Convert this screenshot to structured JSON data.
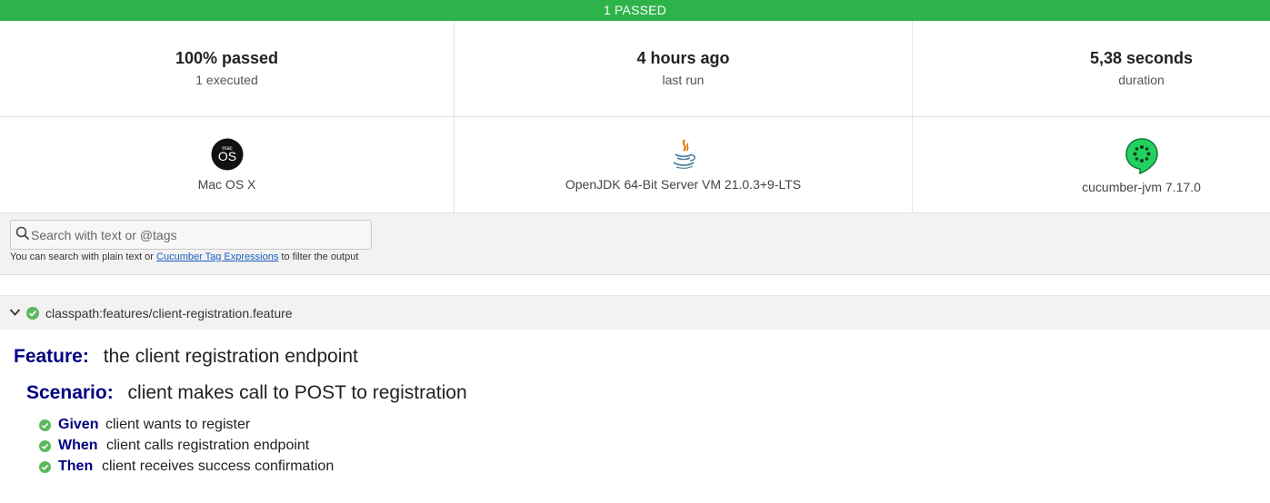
{
  "banner": {
    "text": "1 PASSED",
    "color": "#2db34a"
  },
  "stats": {
    "passed": {
      "value": "100% passed",
      "label": "1 executed"
    },
    "last_run": {
      "value": "4 hours ago",
      "label": "last run"
    },
    "duration": {
      "value": "5,38 seconds",
      "label": "duration"
    }
  },
  "environment": {
    "os": {
      "icon": "macos-icon",
      "icon_text_top": "mac",
      "icon_text_main": "OS",
      "label": "Mac OS X"
    },
    "runtime": {
      "icon": "java-icon",
      "label": "OpenJDK 64-Bit Server VM 21.0.3+9-LTS"
    },
    "framework": {
      "icon": "cucumber-icon",
      "label": "cucumber-jvm 7.17.0"
    }
  },
  "search": {
    "placeholder": "Search with text or @tags",
    "value": "",
    "help_prefix": "You can search with plain text or",
    "help_link": "Cucumber Tag Expressions",
    "help_suffix": "to filter the output"
  },
  "feature_file": {
    "path": "classpath:features/client-registration.feature",
    "status": "passed"
  },
  "feature": {
    "keyword": "Feature:",
    "name": "the client registration endpoint",
    "scenario": {
      "keyword": "Scenario:",
      "name": "client makes call to POST to registration",
      "steps": [
        {
          "keyword": "Given",
          "text": "client wants to register",
          "status": "passed"
        },
        {
          "keyword": "When",
          "text": "client calls registration endpoint",
          "status": "passed"
        },
        {
          "keyword": "Then",
          "text": "client receives success confirmation",
          "status": "passed"
        }
      ]
    }
  },
  "colors": {
    "pass": "#2db34a",
    "check": "#5cb85c",
    "keyword": "#000080",
    "link": "#1a5fc0"
  }
}
